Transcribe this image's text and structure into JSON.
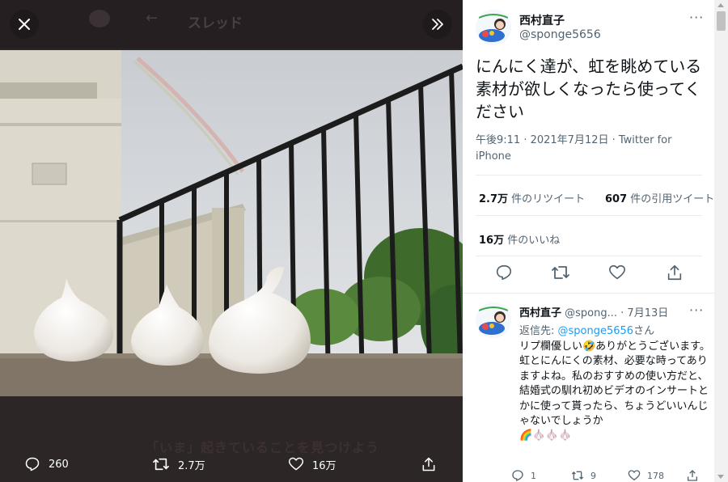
{
  "background": {
    "header_title": "スレッド",
    "footer_text": "「いま」起きていることを見つけよう"
  },
  "viewer": {
    "actions": {
      "reply_count": "260",
      "retweet_count": "2.7万",
      "like_count": "16万"
    }
  },
  "tweet": {
    "author_name": "西村直子",
    "author_handle": "@sponge5656",
    "text": "にんにく達が、虹を眺めている素材が欲しくなったら使ってください",
    "meta": "午後9:11 · 2021年7月12日 · Twitter for iPhone",
    "retweets_value": "2.7万",
    "retweets_label": "件のリツイート",
    "quotes_value": "607",
    "quotes_label": "件の引用ツイート",
    "likes_value": "16万",
    "likes_label": "件のいいね"
  },
  "reply": {
    "author_name": "西村直子",
    "author_handle": "@spong...",
    "date": "· 7月13日",
    "reply_to_prefix": "返信先:",
    "reply_to_handle": "@sponge5656",
    "reply_to_suffix": "さん",
    "text_line1": "リプ欄優しい🤣ありがとうございます。",
    "text_line2": "虹とにんにくの素材、必要な時ってありますよね。私のおすすめの使い方だと、結婚式の馴れ初めビデオのインサートとかに使って貰ったら、ちょうどいいんじゃないでしょうか",
    "text_line3": "🌈🧄🧄🧄",
    "reply_count": "1",
    "retweet_count": "9",
    "like_count": "178"
  },
  "colors": {
    "accent": "#1d9bf0",
    "text_primary": "#0f1419",
    "text_secondary": "#536471"
  }
}
